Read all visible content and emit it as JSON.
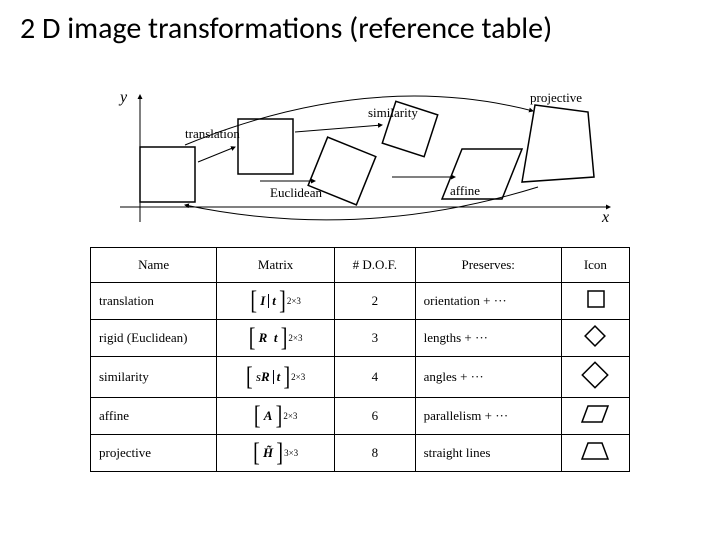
{
  "title": "2 D image transformations (reference table)",
  "axes": {
    "x": "x",
    "y": "y"
  },
  "diagram_labels": {
    "translation": "translation",
    "euclidean": "Euclidean",
    "similarity": "similarity",
    "affine": "affine",
    "projective": "projective"
  },
  "table": {
    "headers": {
      "name": "Name",
      "matrix": "Matrix",
      "dof": "# D.O.F.",
      "preserves": "Preserves:",
      "icon": "Icon"
    },
    "rows": [
      {
        "name": "translation",
        "matrix": {
          "content": [
            "I",
            "t"
          ],
          "bold": [
            true,
            true
          ],
          "sep": "bar",
          "size": "2×3"
        },
        "dof": "2",
        "preserves": "orientation +",
        "icon": "square"
      },
      {
        "name": "rigid (Euclidean)",
        "matrix": {
          "content": [
            "R",
            "t"
          ],
          "bold": [
            true,
            true
          ],
          "sep": "space",
          "size": "2×3"
        },
        "dof": "3",
        "preserves": "lengths +",
        "icon": "diamond"
      },
      {
        "name": "similarity",
        "matrix": {
          "content": [
            "sR",
            "t"
          ],
          "bold": [
            false,
            true
          ],
          "sRbold": true,
          "sep": "bar",
          "size": "2×3"
        },
        "dof": "4",
        "preserves": "angles +",
        "icon": "big-diamond"
      },
      {
        "name": "affine",
        "matrix": {
          "content": [
            "A"
          ],
          "bold": [
            true
          ],
          "sep": "",
          "size": "2×3"
        },
        "dof": "6",
        "preserves": "parallelism +",
        "icon": "parallelogram"
      },
      {
        "name": "projective",
        "matrix": {
          "content": [
            "H̃"
          ],
          "bold": [
            true
          ],
          "sep": "",
          "size": "3×3"
        },
        "dof": "8",
        "preserves": "straight lines",
        "icon": "trapezoid"
      }
    ]
  }
}
